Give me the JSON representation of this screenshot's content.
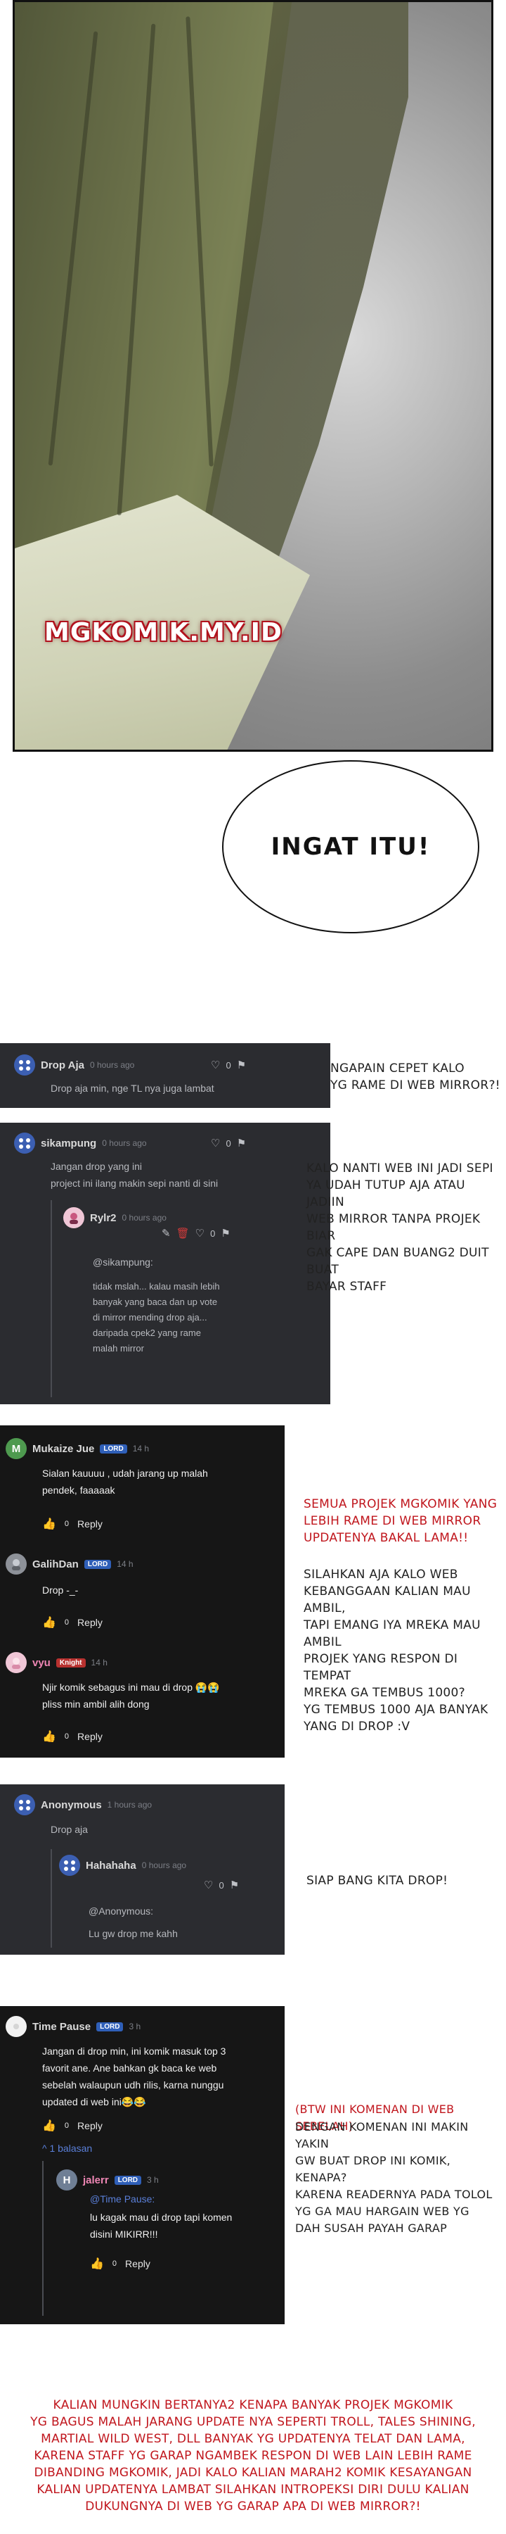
{
  "panel": {
    "watermark": "MGKOMIK.MY.ID",
    "bubble_text": "INGAT ITU!"
  },
  "card1": {
    "user": "Drop Aja",
    "time": "0 hours ago",
    "likes": "0",
    "text": "Drop aja min, nge TL nya juga lambat"
  },
  "note1": [
    "NGAPAIN CEPET KALO",
    "YG RAME DI WEB MIRROR?!"
  ],
  "card2": {
    "user": "sikampung",
    "time": "0 hours ago",
    "likes": "0",
    "text_lines": [
      "Jangan drop yang ini",
      "project ini ilang makin sepi nanti di sini"
    ],
    "reply": {
      "user": "Rylr2",
      "time": "0 hours ago",
      "likes": "0",
      "mention": "@sikampung:",
      "text_lines": [
        "tidak mslah... kalau masih lebih",
        "banyak yang baca dan up vote",
        "di mirror mending drop aja...",
        "daripada cpek2 yang rame",
        "malah mirror"
      ]
    }
  },
  "note2": [
    "KALO NANTI WEB INI JADI SEPI",
    "YA UDAH TUTUP AJA ATAU JADIIN",
    "WEB MIRROR TANPA PROJEK BIAR",
    "GAK CAPE DAN BUANG2 DUIT BUAT",
    "BAYAR STAFF"
  ],
  "card3": {
    "comments": [
      {
        "avatar": "M",
        "user": "Mukaize Jue",
        "badge": "LORD",
        "time": "14 h",
        "text_lines": [
          "Sialan kauuuu , udah jarang up malah",
          "pendek, faaaaak"
        ],
        "count": "0",
        "reply": "Reply"
      },
      {
        "avatar": "",
        "user": "GalihDan",
        "badge": "LORD",
        "time": "14 h",
        "text_lines": [
          "Drop -_-"
        ],
        "count": "0",
        "reply": "Reply"
      },
      {
        "avatar": "",
        "user": "vyu",
        "badge": "Knight",
        "time": "14 h",
        "text_lines": [
          "Njir komik sebagus ini mau di drop 😭😭",
          "pliss min ambil alih dong"
        ],
        "count": "0",
        "reply": "Reply"
      }
    ]
  },
  "note3_red": [
    "SEMUA PROJEK MGKOMIK YANG",
    "LEBIH RAME DI WEB MIRROR",
    "UPDATENYA BAKAL LAMA!!"
  ],
  "note3": [
    "SILAHKAN AJA KALO WEB",
    "KEBANGGAAN KALIAN MAU AMBIL,",
    "TAPI EMANG IYA MREKA MAU AMBIL",
    "PROJEK YANG RESPON DI TEMPAT",
    "MREKA GA TEMBUS 1000?",
    "YG TEMBUS 1000 AJA BANYAK",
    "YANG DI DROP :V"
  ],
  "card4": {
    "user": "Anonymous",
    "time": "1 hours ago",
    "likes": "0",
    "text": "Drop aja",
    "reply": {
      "user": "Hahahaha",
      "time": "0 hours ago",
      "likes": "0",
      "mention": "@Anonymous:",
      "text": "Lu gw drop me kahh"
    }
  },
  "note4": [
    "SIAP BANG KITA DROP!"
  ],
  "card5": {
    "user": "Time Pause",
    "badge": "LORD",
    "time": "3 h",
    "text_lines": [
      "Jangan di drop min, ini komik masuk top 3",
      "favorit ane. Ane bahkan gk baca ke web",
      "sebelah walaupun udh rilis, karna nunggu",
      "updated di web ini😂😂"
    ],
    "count": "0",
    "reply": "Reply",
    "replies_toggle": "^ 1 balasan",
    "sub": {
      "avatar": "H",
      "user": "jalerr",
      "badge": "LORD",
      "time": "3 h",
      "mention": "@Time Pause:",
      "text_lines": [
        "lu kagak mau di drop tapi komen",
        "disini MIKIRR!!!"
      ],
      "count": "0",
      "reply": "Reply"
    }
  },
  "note5_red": [
    "(BTW INI KOMENAN DI WEB SEBELAH)"
  ],
  "note5": [
    "DENGAN KOMENAN INI MAKIN YAKIN",
    "GW BUAT DROP INI KOMIK, KENAPA?",
    "KARENA READERNYA PADA TOLOL",
    "YG GA MAU HARGAIN WEB YG",
    "DAH SUSAH PAYAH GARAP"
  ],
  "footer": [
    "KALIAN MUNGKIN BERTANYA2 KENAPA BANYAK PROJEK MGKOMIK",
    "YG BAGUS MALAH JARANG UPDATE NYA SEPERTI TROLL, TALES SHINING,",
    "MARTIAL WILD WEST, DLL BANYAK YG UPDATENYA TELAT DAN LAMA,",
    "KARENA STAFF YG GARAP NGAMBEK RESPON DI WEB LAIN LEBIH RAME",
    "DIBANDING MGKOMIK, JADI KALO KALIAN MARAH2 KOMIK KESAYANGAN",
    "KALIAN UPDATENYA LAMBAT SILAHKAN INTROPEKSI DIRI DULU KALIAN",
    "DUKUNGNYA DI WEB YG GARAP APA DI WEB MIRROR?!"
  ]
}
